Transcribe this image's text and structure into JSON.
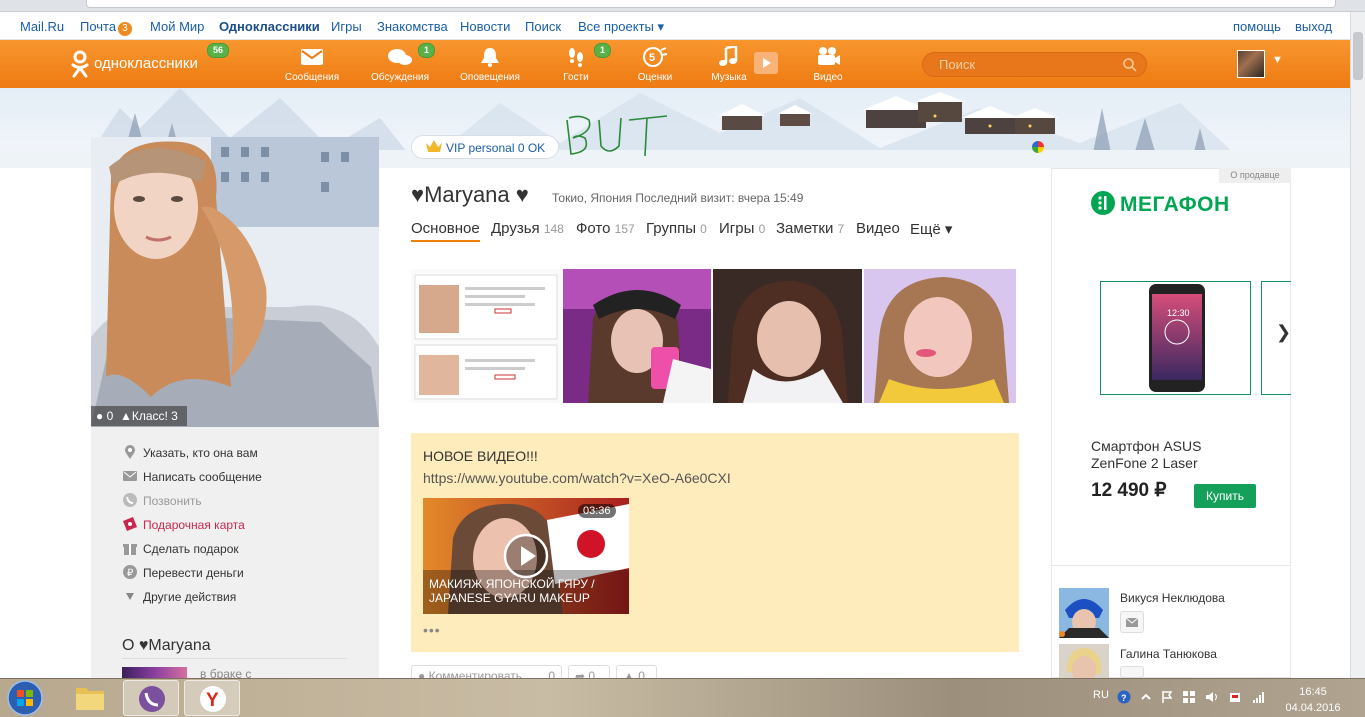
{
  "topnav": {
    "links": [
      "Mail.Ru",
      "Почта",
      "Мой Мир",
      "Одноклассники",
      "Игры",
      "Знакомства",
      "Новости",
      "Поиск",
      "Все проекты ▾"
    ],
    "mail_count": "3",
    "help": "помощь",
    "logout": "выход"
  },
  "header": {
    "logo": "одноклассники",
    "logo_badge": "56",
    "nav": [
      {
        "label": "Сообщения",
        "icon": "envelope-icon",
        "badge": ""
      },
      {
        "label": "Обсуждения",
        "icon": "chat-bubbles-icon",
        "badge": "1"
      },
      {
        "label": "Оповещения",
        "icon": "bell-icon",
        "badge": ""
      },
      {
        "label": "Гости",
        "icon": "footprints-icon",
        "badge": "1"
      },
      {
        "label": "Оценки",
        "icon": "rating-five-icon",
        "badge": ""
      },
      {
        "label": "Музыка",
        "icon": "music-note-icon",
        "badge": ""
      },
      {
        "label": "Видео",
        "icon": "video-camera-icon",
        "badge": ""
      }
    ],
    "search_placeholder": "Поиск"
  },
  "profile": {
    "comments_count": "0",
    "klass_label": "Класс! 3",
    "actions": [
      "Указать, кто она вам",
      "Написать сообщение",
      "Позвонить",
      "Подарочная карта",
      "Сделать подарок",
      "Перевести деньги",
      "Другие действия"
    ],
    "about_title": "О ♥Maryana",
    "about_text": "в браке с"
  },
  "main": {
    "vip_label": "VIP personal 0 OK",
    "scribble": "BUT",
    "name": "♥Maryana ♥",
    "meta": "Токио, Япония Последний визит: вчера 15:49",
    "tabs": [
      {
        "label": "Основное",
        "count": ""
      },
      {
        "label": "Друзья",
        "count": "148"
      },
      {
        "label": "Фото",
        "count": "157"
      },
      {
        "label": "Группы",
        "count": "0"
      },
      {
        "label": "Игры",
        "count": "0"
      },
      {
        "label": "Заметки",
        "count": "7"
      },
      {
        "label": "Видео",
        "count": ""
      },
      {
        "label": "Ещё ▾",
        "count": ""
      }
    ],
    "post": {
      "title": "НОВОЕ ВИДЕО!!!",
      "url": "https://www.youtube.com/watch?v=XeO-A6e0CXI",
      "video_duration": "03:36",
      "video_title": "МАКИЯЖ ЯПОНСКОЙ ГЯРУ / JAPANESE GYARU MAKEUP",
      "more": "•••",
      "buttons": [
        {
          "label": "Комментировать",
          "count": "0"
        },
        {
          "label": "",
          "count": "0"
        },
        {
          "label": "",
          "count": "0"
        }
      ]
    }
  },
  "ad": {
    "tag": "О продавце",
    "brand": "МЕГАФОН",
    "product": "Смартфон ASUS ZenFone 2 Laser",
    "price": "12 490 ₽",
    "buy": "Купить"
  },
  "friends": [
    {
      "name": "Викуся Неклюдова"
    },
    {
      "name": "Галина Танюкова"
    }
  ],
  "taskbar": {
    "lang": "RU",
    "time": "16:45",
    "date": "04.04.2016"
  }
}
